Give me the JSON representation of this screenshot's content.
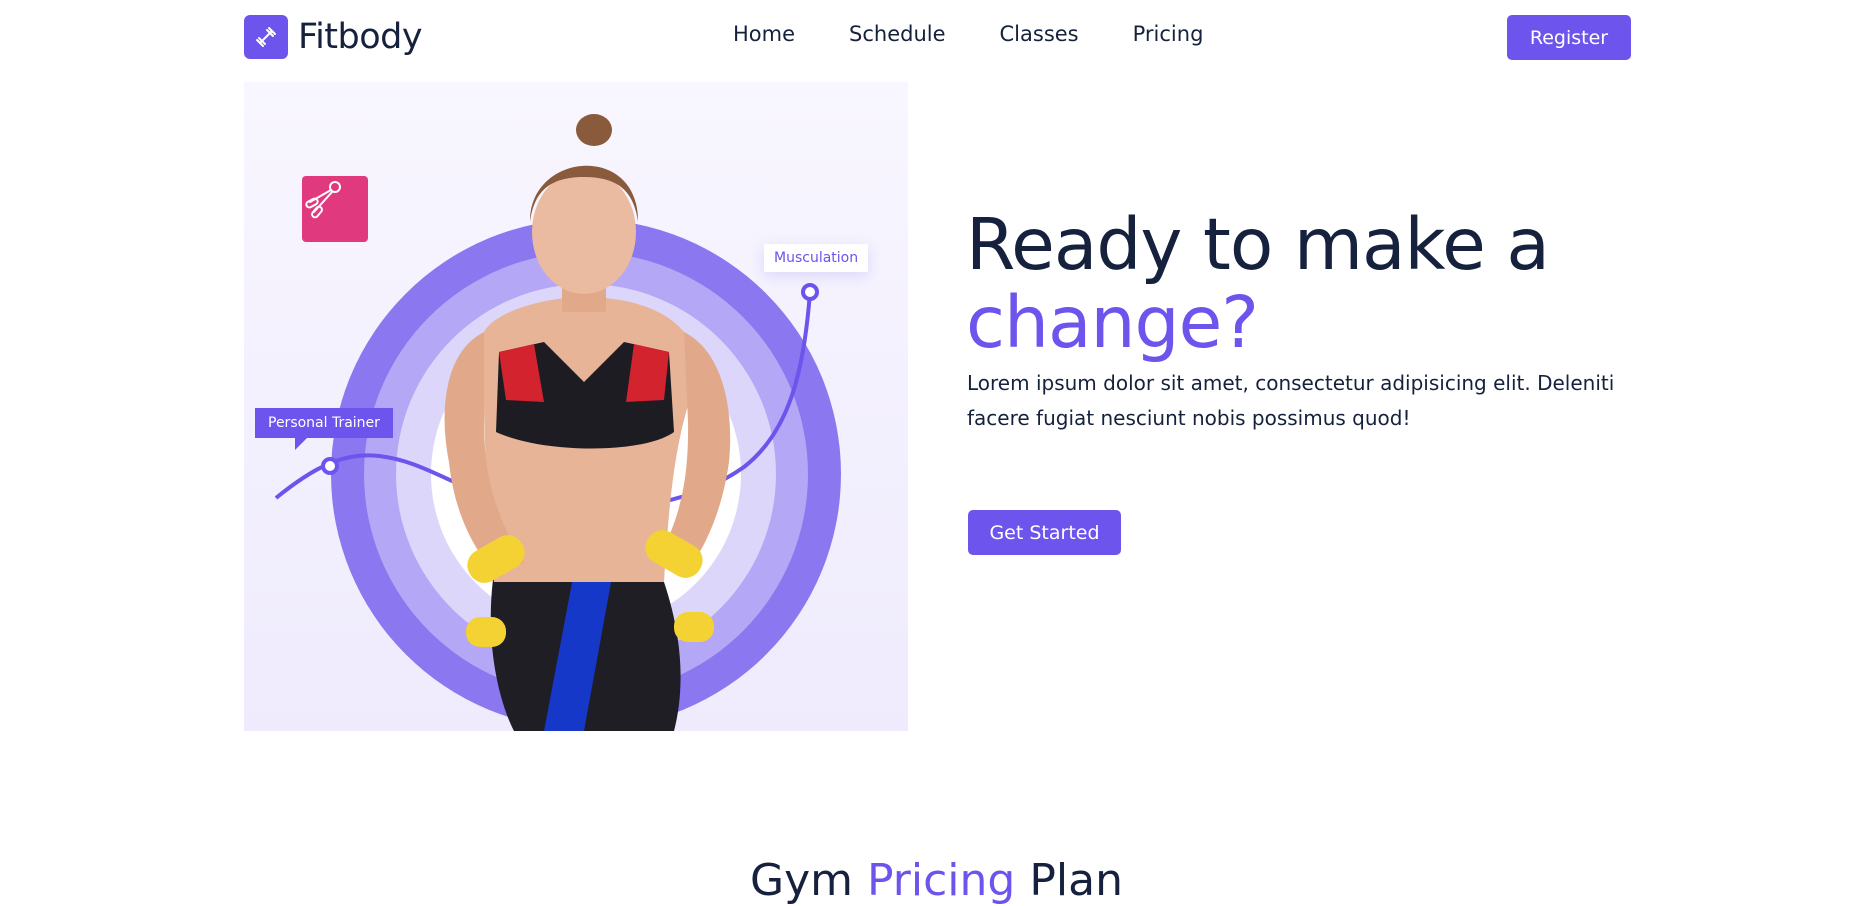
{
  "brand": {
    "name": "Fitbody",
    "icon": "dumbbell-icon",
    "accent_color": "#6c54ec"
  },
  "nav": {
    "items": [
      {
        "label": "Home"
      },
      {
        "label": "Schedule"
      },
      {
        "label": "Classes"
      },
      {
        "label": "Pricing"
      }
    ],
    "register_label": "Register"
  },
  "hero": {
    "title_line1": "Ready to make a",
    "title_line2": "change?",
    "description": "Lorem ipsum dolor sit amet, consectetur adipisicing elit. Deleniti facere fugiat nesciunt nobis possimus quod!",
    "cta_label": "Get Started",
    "image": {
      "tag_trainer": "Personal Trainer",
      "tag_musculation": "Musculation",
      "badge_icon": "hand-gripper-icon",
      "badge_color": "#e0397d"
    }
  },
  "pricing_section": {
    "title_start": "Gym",
    "title_accent": "Pricing",
    "title_end": "Plan"
  }
}
